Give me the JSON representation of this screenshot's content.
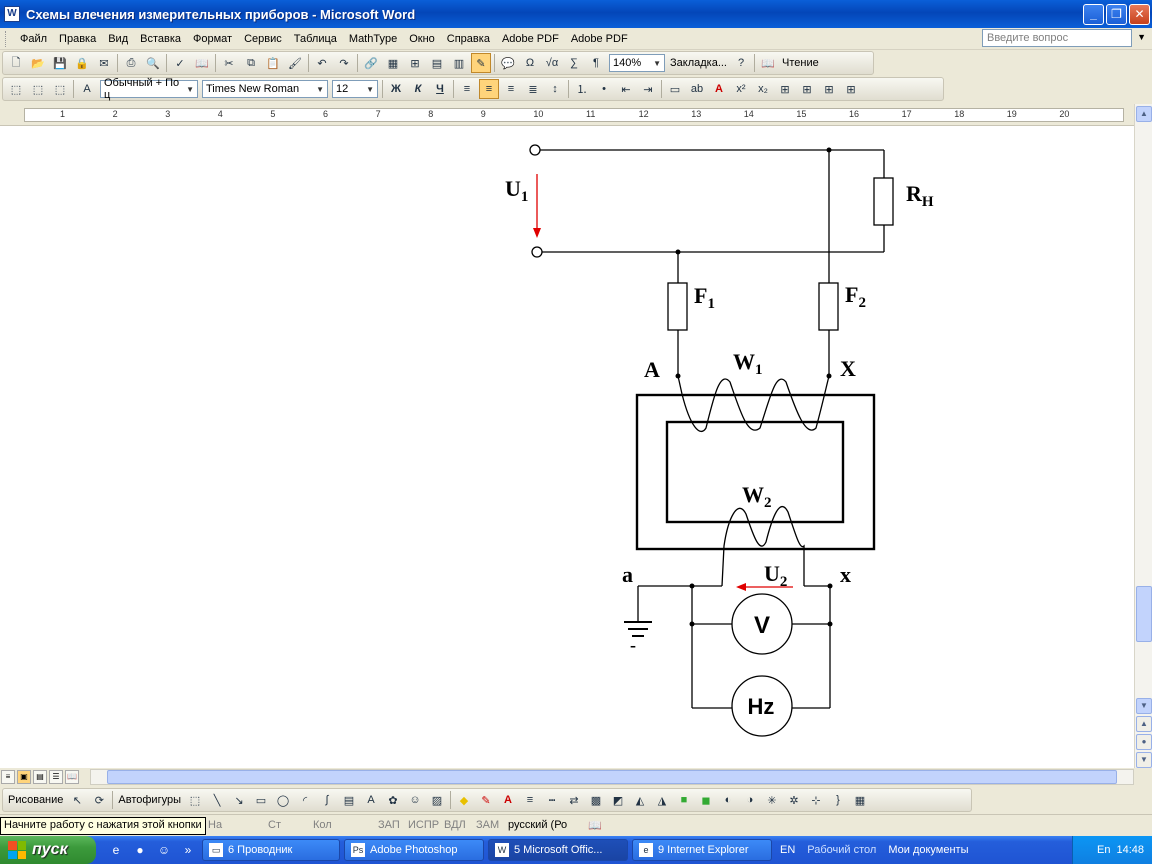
{
  "window": {
    "title": "Схемы влечения измерительных приборов - Microsoft Word",
    "icon": "word-doc-icon"
  },
  "menu": {
    "items": [
      "Файл",
      "Правка",
      "Вид",
      "Вставка",
      "Формат",
      "Сервис",
      "Таблица",
      "MathType",
      "Окно",
      "Справка",
      "Adobe PDF",
      "Adobe PDF"
    ],
    "help_placeholder": "Введите вопрос"
  },
  "toolbar1": {
    "zoom": "140%",
    "bookmark_label": "Закладка...",
    "reading_label": "Чтение"
  },
  "toolbar2": {
    "style": "Обычный + По ц",
    "font": "Times New Roman",
    "size": "12",
    "bold": "Ж",
    "italic": "К",
    "underline": "Ч"
  },
  "ruler": {
    "numbers": [
      "1",
      "2",
      "3",
      "4",
      "5",
      "6",
      "7",
      "8",
      "9",
      "10",
      "11",
      "12",
      "13",
      "14",
      "15",
      "16",
      "17",
      "18",
      "19",
      "20"
    ]
  },
  "diagram": {
    "u1": "U",
    "u1_sub": "1",
    "rh": "R",
    "rh_sub": "H",
    "f1": "F",
    "f1_sub": "1",
    "f2": "F",
    "f2_sub": "2",
    "a_upper": "A",
    "x_upper": "X",
    "w1": "W",
    "w1_sub": "1",
    "w2": "W",
    "w2_sub": "2",
    "a_lower": "a",
    "x_lower": "x",
    "u2": "U",
    "u2_sub": "2",
    "voltmeter": "V",
    "freq": "Hz",
    "minus": "-"
  },
  "drawbar": {
    "draw_label": "Рисование",
    "autoshapes_label": "Автофигуры"
  },
  "status": {
    "page_hint": "На",
    "st": "Ст",
    "col": "Кол",
    "rec": "ЗАП",
    "fix": "ИСПР",
    "ext": "ВДЛ",
    "ovr": "ЗАМ",
    "lang": "русский (Ро"
  },
  "tooltip": "Начните работу с нажатия этой кнопки",
  "taskbar": {
    "start": "пуск",
    "tasks": [
      "6 Проводник",
      "Adobe Photoshop",
      "5 Microsoft Offic...",
      "9 Internet Explorer"
    ],
    "lang": "EN",
    "desktop": "Рабочий стол",
    "mydocs": "Мои документы",
    "tray_lang": "En",
    "time": "14:48"
  },
  "colors": {
    "arrow": "#e00000",
    "title_blue": "#0a5fd8",
    "accent": "#ffd47b"
  }
}
